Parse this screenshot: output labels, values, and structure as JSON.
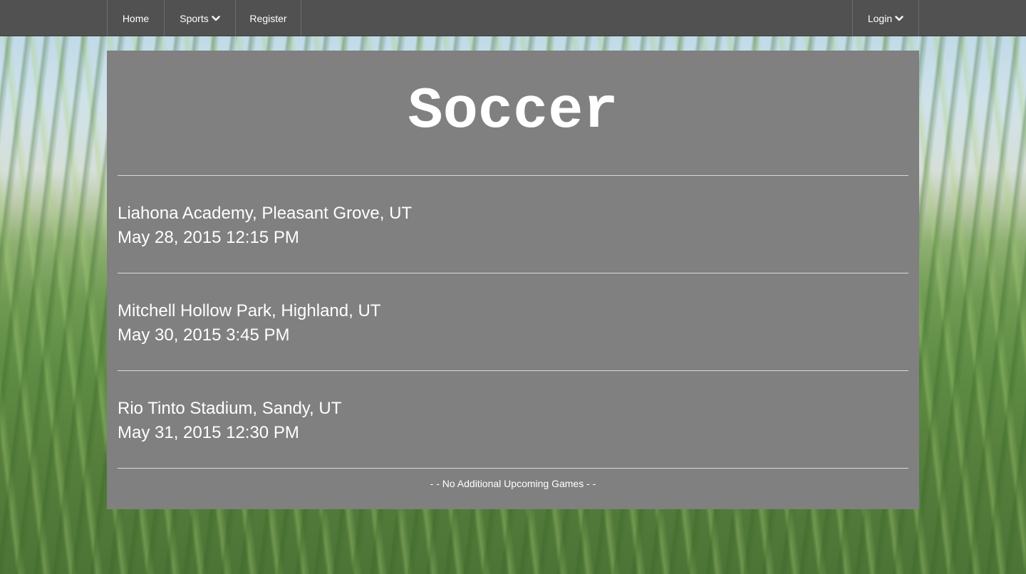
{
  "nav": {
    "home_label": "Home",
    "sports_label": "Sports",
    "register_label": "Register",
    "login_label": "Login",
    "dropdown_icon": "chevron-down-icon"
  },
  "page": {
    "title": "Soccer"
  },
  "games": [
    {
      "location": "Liahona Academy, Pleasant Grove, UT",
      "datetime": "May 28, 2015 12:15 PM"
    },
    {
      "location": "Mitchell Hollow Park, Highland, UT",
      "datetime": "May 30, 2015 3:45 PM"
    },
    {
      "location": "Rio Tinto Stadium, Sandy, UT",
      "datetime": "May 31, 2015 12:30 PM"
    }
  ],
  "footer_note": "- - No Additional Upcoming Games - -",
  "colors": {
    "navbar": "#515151",
    "panel": "#808080",
    "text": "#ffffff"
  }
}
